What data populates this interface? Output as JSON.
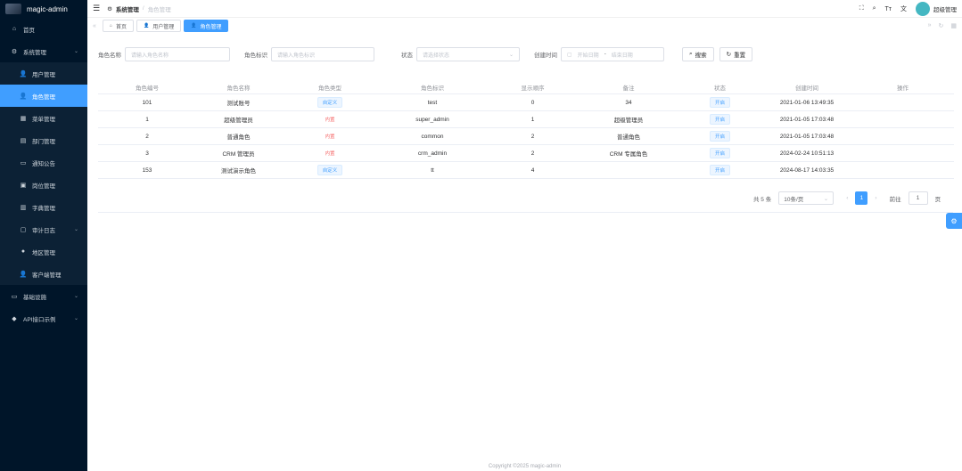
{
  "app": {
    "title": "magic-admin"
  },
  "sidebar": {
    "items": [
      {
        "label": "首页",
        "icon": "home-icon"
      },
      {
        "label": "系统管理",
        "icon": "gear-icon",
        "expanded": true
      },
      {
        "label": "用户管理",
        "icon": "user-icon",
        "sub": true
      },
      {
        "label": "角色管理",
        "icon": "user-icon",
        "sub": true,
        "active": true
      },
      {
        "label": "菜单管理",
        "icon": "grid-icon",
        "sub": true
      },
      {
        "label": "部门管理",
        "icon": "tree-icon",
        "sub": true
      },
      {
        "label": "通知公告",
        "icon": "message-icon",
        "sub": true
      },
      {
        "label": "岗位管理",
        "icon": "post-icon",
        "sub": true
      },
      {
        "label": "字典管理",
        "icon": "book-icon",
        "sub": true
      },
      {
        "label": "审计日志",
        "icon": "log-icon",
        "sub": true
      },
      {
        "label": "地区管理",
        "icon": "location-icon",
        "sub": true
      },
      {
        "label": "客户端管理",
        "icon": "user-icon",
        "sub": true
      },
      {
        "label": "基础设施",
        "icon": "infra-icon"
      },
      {
        "label": "API接口示例",
        "icon": "apple-icon"
      }
    ]
  },
  "header": {
    "breadcrumb_1": "系统管理",
    "breadcrumb_sep": "/",
    "breadcrumb_2": "角色管理",
    "username": "超级管理"
  },
  "tags": [
    {
      "label": "首页",
      "icon": "home-icon"
    },
    {
      "label": "用户管理",
      "icon": "user-icon"
    },
    {
      "label": "角色管理",
      "icon": "user-icon",
      "active": true
    }
  ],
  "search": {
    "name_label": "角色名称",
    "name_placeholder": "请输入角色名称",
    "code_label": "角色标识",
    "code_placeholder": "请输入角色标识",
    "status_label": "状态",
    "status_placeholder": "请选择状态",
    "time_label": "创建时间",
    "start_placeholder": "开始日期",
    "range_sep": "-",
    "end_placeholder": "结束日期",
    "search_btn": "搜索",
    "reset_btn": "重置"
  },
  "table": {
    "columns": [
      "角色编号",
      "角色名称",
      "角色类型",
      "角色标识",
      "显示顺序",
      "备注",
      "状态",
      "创建时间",
      "操作"
    ],
    "rows": [
      {
        "id": "101",
        "name": "测试账号",
        "type": "自定义",
        "type_kind": "custom",
        "code": "test",
        "sort": "0",
        "remark": "34",
        "status": "开启",
        "created": "2021-01-06 13:49:35"
      },
      {
        "id": "1",
        "name": "超级管理员",
        "type": "内置",
        "type_kind": "builtin",
        "code": "super_admin",
        "sort": "1",
        "remark": "超级管理员",
        "status": "开启",
        "created": "2021-01-05 17:03:48"
      },
      {
        "id": "2",
        "name": "普通角色",
        "type": "内置",
        "type_kind": "builtin",
        "code": "common",
        "sort": "2",
        "remark": "普通角色",
        "status": "开启",
        "created": "2021-01-05 17:03:48"
      },
      {
        "id": "3",
        "name": "CRM 管理员",
        "type": "内置",
        "type_kind": "builtin",
        "code": "crm_admin",
        "sort": "2",
        "remark": "CRM 专属角色",
        "status": "开启",
        "created": "2024-02-24 10:51:13"
      },
      {
        "id": "153",
        "name": "测试演示角色",
        "type": "自定义",
        "type_kind": "custom",
        "code": "tt",
        "sort": "4",
        "remark": "",
        "status": "开启",
        "created": "2024-08-17 14:03:35"
      }
    ]
  },
  "pagination": {
    "total": "共 5 条",
    "page_size": "10条/页",
    "current": "1",
    "goto_label": "前往",
    "goto_value": "1",
    "page_suffix": "页"
  },
  "footer": {
    "text": "Copyright ©2025 magic-admin"
  },
  "colors": {
    "primary": "#409eff",
    "sidebar": "#001529",
    "danger": "#f56c6c"
  }
}
